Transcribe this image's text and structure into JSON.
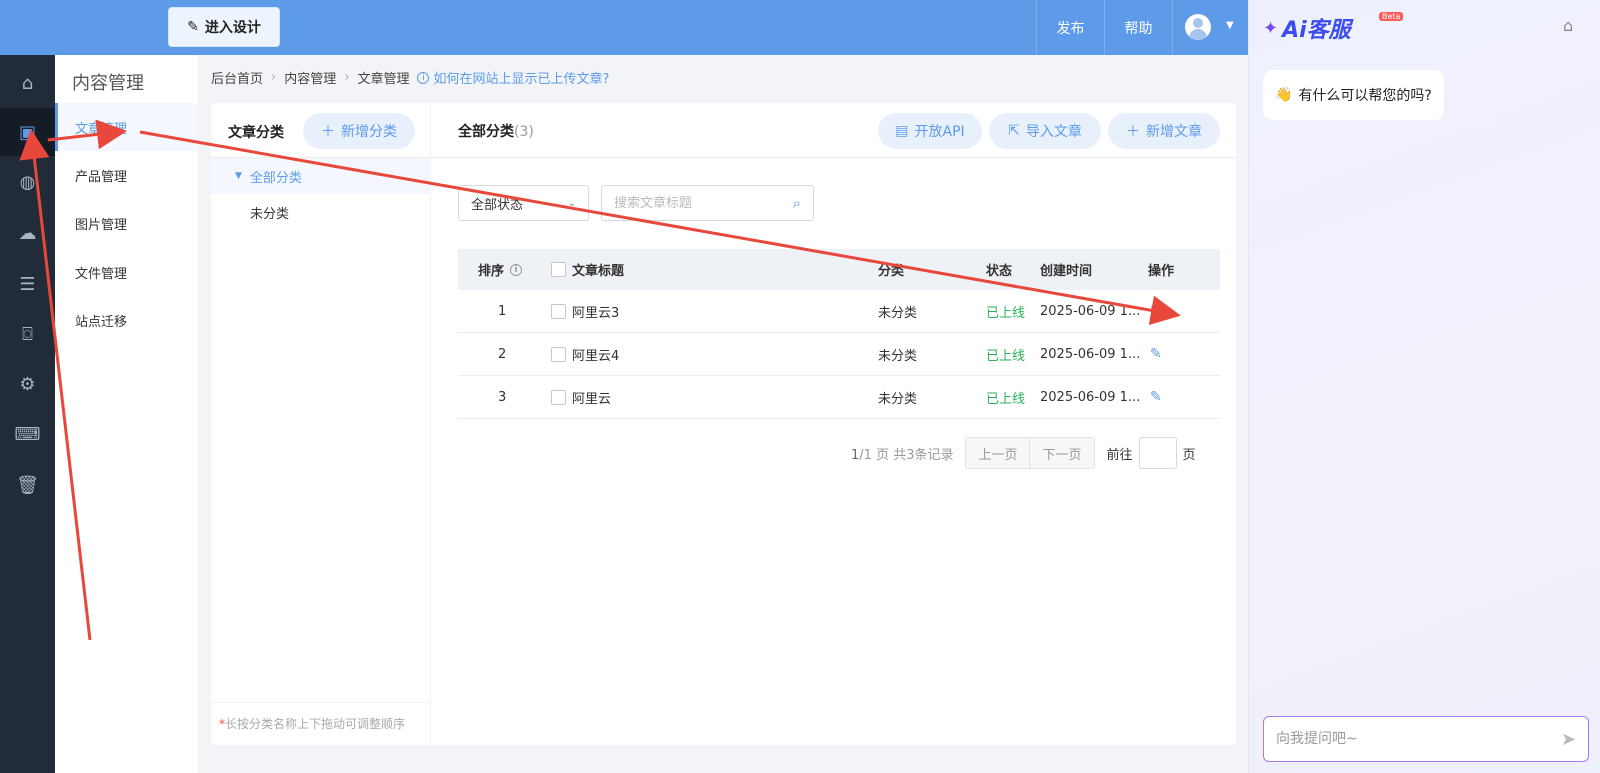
{
  "topbar": {
    "design_label": "进入设计",
    "publish_label": "发布",
    "help_label": "帮助"
  },
  "submenu": {
    "title": "内容管理",
    "items": [
      {
        "label": "文章管理"
      },
      {
        "label": "产品管理"
      },
      {
        "label": "图片管理"
      },
      {
        "label": "文件管理"
      },
      {
        "label": "站点迁移"
      }
    ]
  },
  "breadcrumb": {
    "home": "后台首页",
    "section": "内容管理",
    "page": "文章管理",
    "help": "如何在网站上显示已上传文章?"
  },
  "category_panel": {
    "title": "文章分类",
    "add_label": "新增分类",
    "nodes": [
      {
        "label": "全部分类"
      },
      {
        "label": "未分类"
      }
    ],
    "tip_star": "*",
    "tip": "长按分类名称上下拖动可调整顺序"
  },
  "list": {
    "title": "全部分类",
    "count": "(3)",
    "api_label": "开放API",
    "import_label": "导入文章",
    "add_label": "新增文章",
    "status_select": "全部状态",
    "search_placeholder": "搜索文章标题"
  },
  "table": {
    "headers": {
      "order": "排序",
      "title": "文章标题",
      "category": "分类",
      "status": "状态",
      "created": "创建时间",
      "action": "操作"
    },
    "rows": [
      {
        "order": "1",
        "title": "阿里云3",
        "category": "未分类",
        "status": "已上线",
        "created": "2025-06-09 1..."
      },
      {
        "order": "2",
        "title": "阿里云4",
        "category": "未分类",
        "status": "已上线",
        "created": "2025-06-09 1..."
      },
      {
        "order": "3",
        "title": "阿里云",
        "category": "未分类",
        "status": "已上线",
        "created": "2025-06-09 1..."
      }
    ]
  },
  "pager": {
    "current": "1",
    "total": "/1 页 共3条记录",
    "prev": "上一页",
    "next": "下一页",
    "goto": "前往",
    "page_unit": "页"
  },
  "ai_panel": {
    "logo_text": "Ai客服",
    "beta": "Beta",
    "greeting": "有什么可以帮您的吗?",
    "input_placeholder": "向我提问吧~"
  },
  "colors": {
    "primary": "#5d9be9",
    "rail": "#222b38",
    "online": "#2bb15a",
    "arrow": "#e8483b"
  }
}
